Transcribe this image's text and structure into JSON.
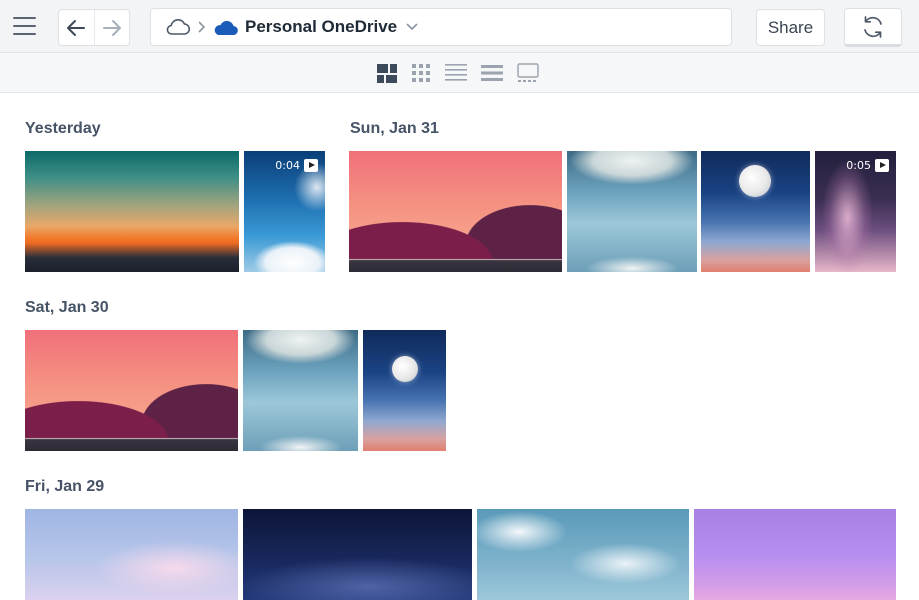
{
  "toolbar": {
    "location_title": "Personal OneDrive",
    "share_label": "Share"
  },
  "sections": [
    {
      "label": "Yesterday",
      "items": [
        {
          "kind": "photo",
          "subject": "sunset over horizon"
        },
        {
          "kind": "video",
          "subject": "clouds in blue sky",
          "duration": "0:04"
        }
      ]
    },
    {
      "label": "Sun, Jan 31",
      "items": [
        {
          "kind": "photo",
          "subject": "pink mountains"
        },
        {
          "kind": "photo",
          "subject": "sun rays through clouds"
        },
        {
          "kind": "photo",
          "subject": "moon in blue sky"
        },
        {
          "kind": "video",
          "subject": "milky way",
          "duration": "0:05"
        }
      ]
    },
    {
      "label": "Sat, Jan 30",
      "items": [
        {
          "kind": "photo",
          "subject": "pink mountains"
        },
        {
          "kind": "photo",
          "subject": "sun rays through clouds"
        },
        {
          "kind": "photo",
          "subject": "moon in blue sky"
        }
      ]
    },
    {
      "label": "Fri, Jan 29",
      "items": [
        {
          "kind": "photo",
          "subject": "pastel sky"
        },
        {
          "kind": "photo",
          "subject": "starry night sky"
        },
        {
          "kind": "photo",
          "subject": "sunlit clouds"
        },
        {
          "kind": "photo",
          "subject": "violet sky"
        }
      ]
    }
  ],
  "icons": {
    "menu": "hamburger-icon",
    "back": "arrow-left-icon",
    "forward": "arrow-right-icon",
    "cloud": "cloud-icon",
    "onedrive": "onedrive-icon",
    "dropdown": "chevron-down-icon",
    "sync": "sync-icon",
    "views": [
      "tiles-view-icon",
      "grid-view-icon",
      "list-view-icon",
      "details-view-icon",
      "filmstrip-view-icon"
    ]
  },
  "colors": {
    "accent": "#1a5ab8",
    "toolbar_bg": "#f3f4f6",
    "label_text": "#465366"
  }
}
